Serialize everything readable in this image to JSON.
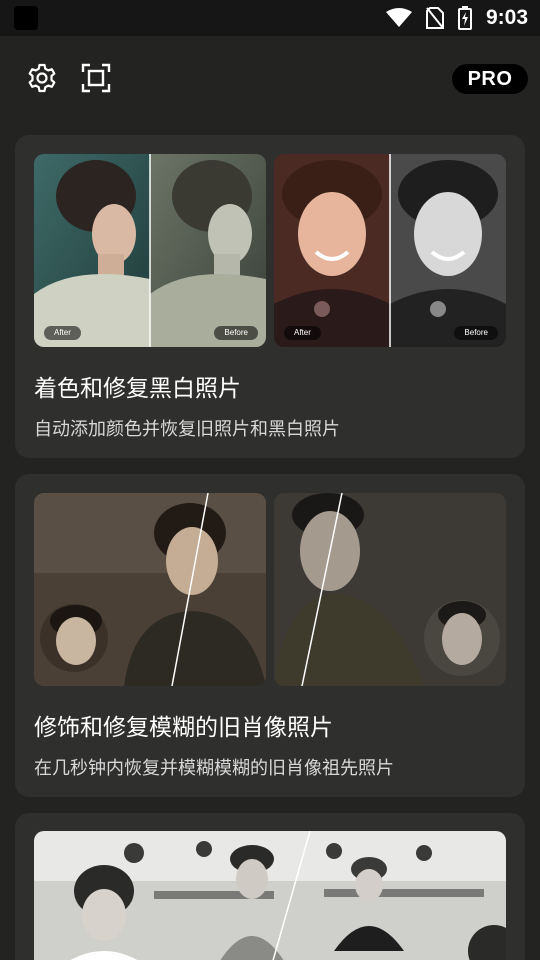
{
  "status_bar": {
    "time": "9:03",
    "icons": [
      "app-icon",
      "wifi-icon",
      "no-sim-icon",
      "battery-icon"
    ]
  },
  "toolbar": {
    "icons": [
      "settings-gear-icon",
      "scan-frame-icon"
    ],
    "pro_label": "PRO"
  },
  "cards": [
    {
      "title": "着色和修复黑白照片",
      "description": "自动添加颜色并恢复旧照片和黑白照片",
      "images": [
        {
          "after_label": "After",
          "before_label": "Before",
          "subject": "victorian-woman-portrait"
        },
        {
          "after_label": "After",
          "before_label": "Before",
          "subject": "smiling-woman-portrait"
        }
      ]
    },
    {
      "title": "修饰和修复模糊的旧肖像照片",
      "description": "在几秒钟内恢复并模糊模糊的旧肖像祖先照片",
      "images": [
        {
          "subject": "woman-in-uniform-portrait"
        },
        {
          "subject": "man-in-uniform-portrait"
        }
      ]
    },
    {
      "images": [
        {
          "subject": "classroom-bw-photo"
        }
      ]
    }
  ],
  "colors": {
    "background": "#232322",
    "card": "#2f2f2e",
    "status_bar": "#161616",
    "badge": "#000000"
  }
}
